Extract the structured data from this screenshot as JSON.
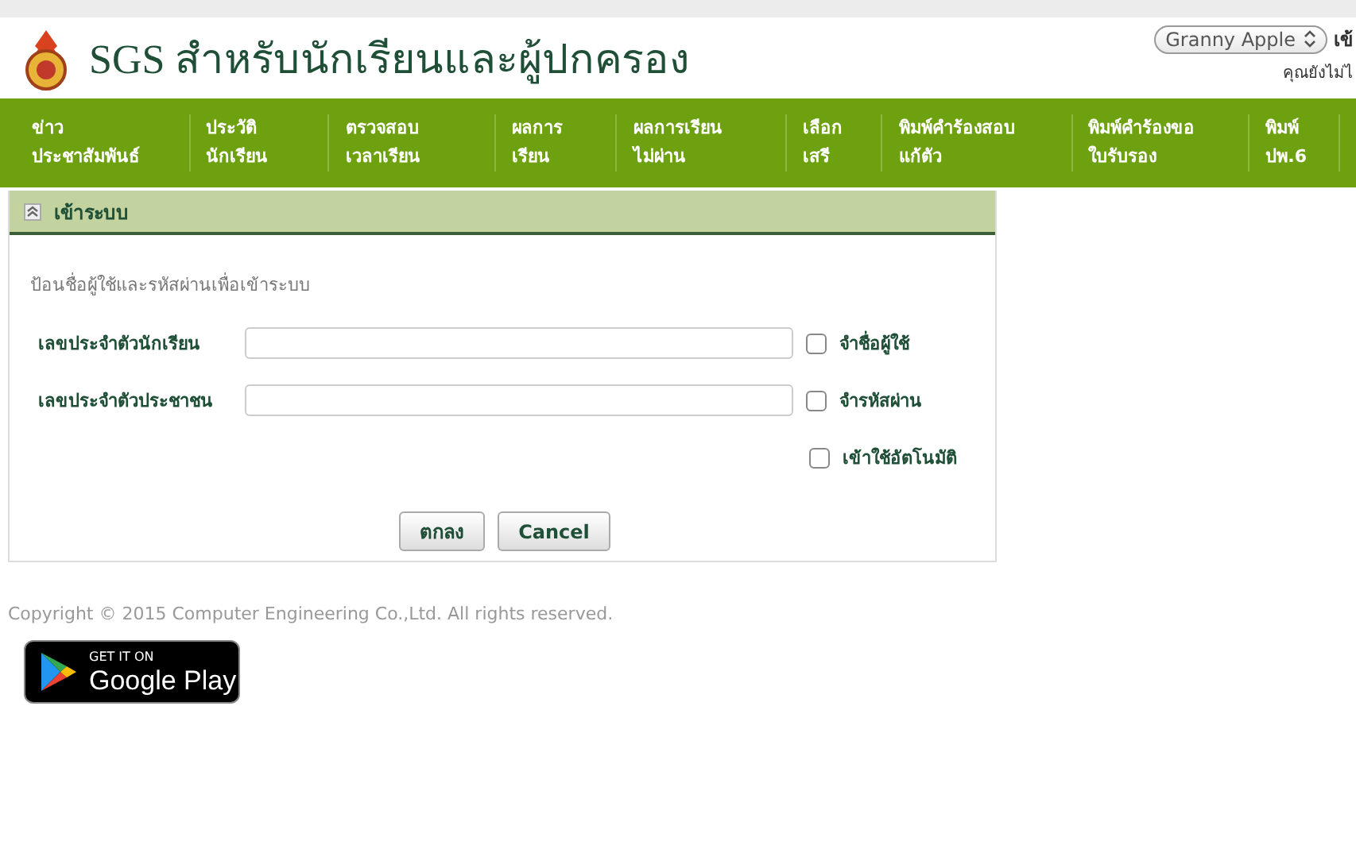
{
  "header": {
    "title": "SGS สำหรับนักเรียนและผู้ปกครอง",
    "theme_select": "Granny Apple",
    "login_link": "เข้",
    "status": "คุณยังไม่ไ"
  },
  "nav": [
    {
      "label": "ข่าว\nประชาสัมพันธ์"
    },
    {
      "label": "ประวัติ\nนักเรียน"
    },
    {
      "label": "ตรวจสอบ\nเวลาเรียน"
    },
    {
      "label": "ผลการ\nเรียน"
    },
    {
      "label": "ผลการเรียน\nไม่ผ่าน"
    },
    {
      "label": "เลือก\nเสรี"
    },
    {
      "label": "พิมพ์คำร้องสอบ\nแก้ตัว"
    },
    {
      "label": "พิมพ์คำร้องขอ\nใบรับรอง"
    },
    {
      "label": "พิมพ์\nปพ.6"
    }
  ],
  "panel": {
    "title": "เข้าระบบ",
    "expanded": true,
    "instruction": "ป้อนชื่อผู้ใช้และรหัสผ่านเพื่อเข้าระบบ",
    "fields": [
      {
        "label": "เลขประจำตัวนักเรียน",
        "checkbox": "จำชื่อผู้ใช้",
        "checked": false
      },
      {
        "label": "เลขประจำตัวประชาชน",
        "checkbox": "จำรหัสผ่าน",
        "checked": false
      }
    ],
    "auto_login": {
      "label": "เข้าใช้อัตโนมัติ",
      "checked": false
    },
    "buttons": [
      "ตกลง",
      "Cancel"
    ]
  },
  "footer": {
    "copyright": "Copyright © 2015 Computer Engineering Co.,Ltd. All rights reserved.",
    "badge_top": "GET IT ON",
    "badge_name": "Google Play"
  }
}
